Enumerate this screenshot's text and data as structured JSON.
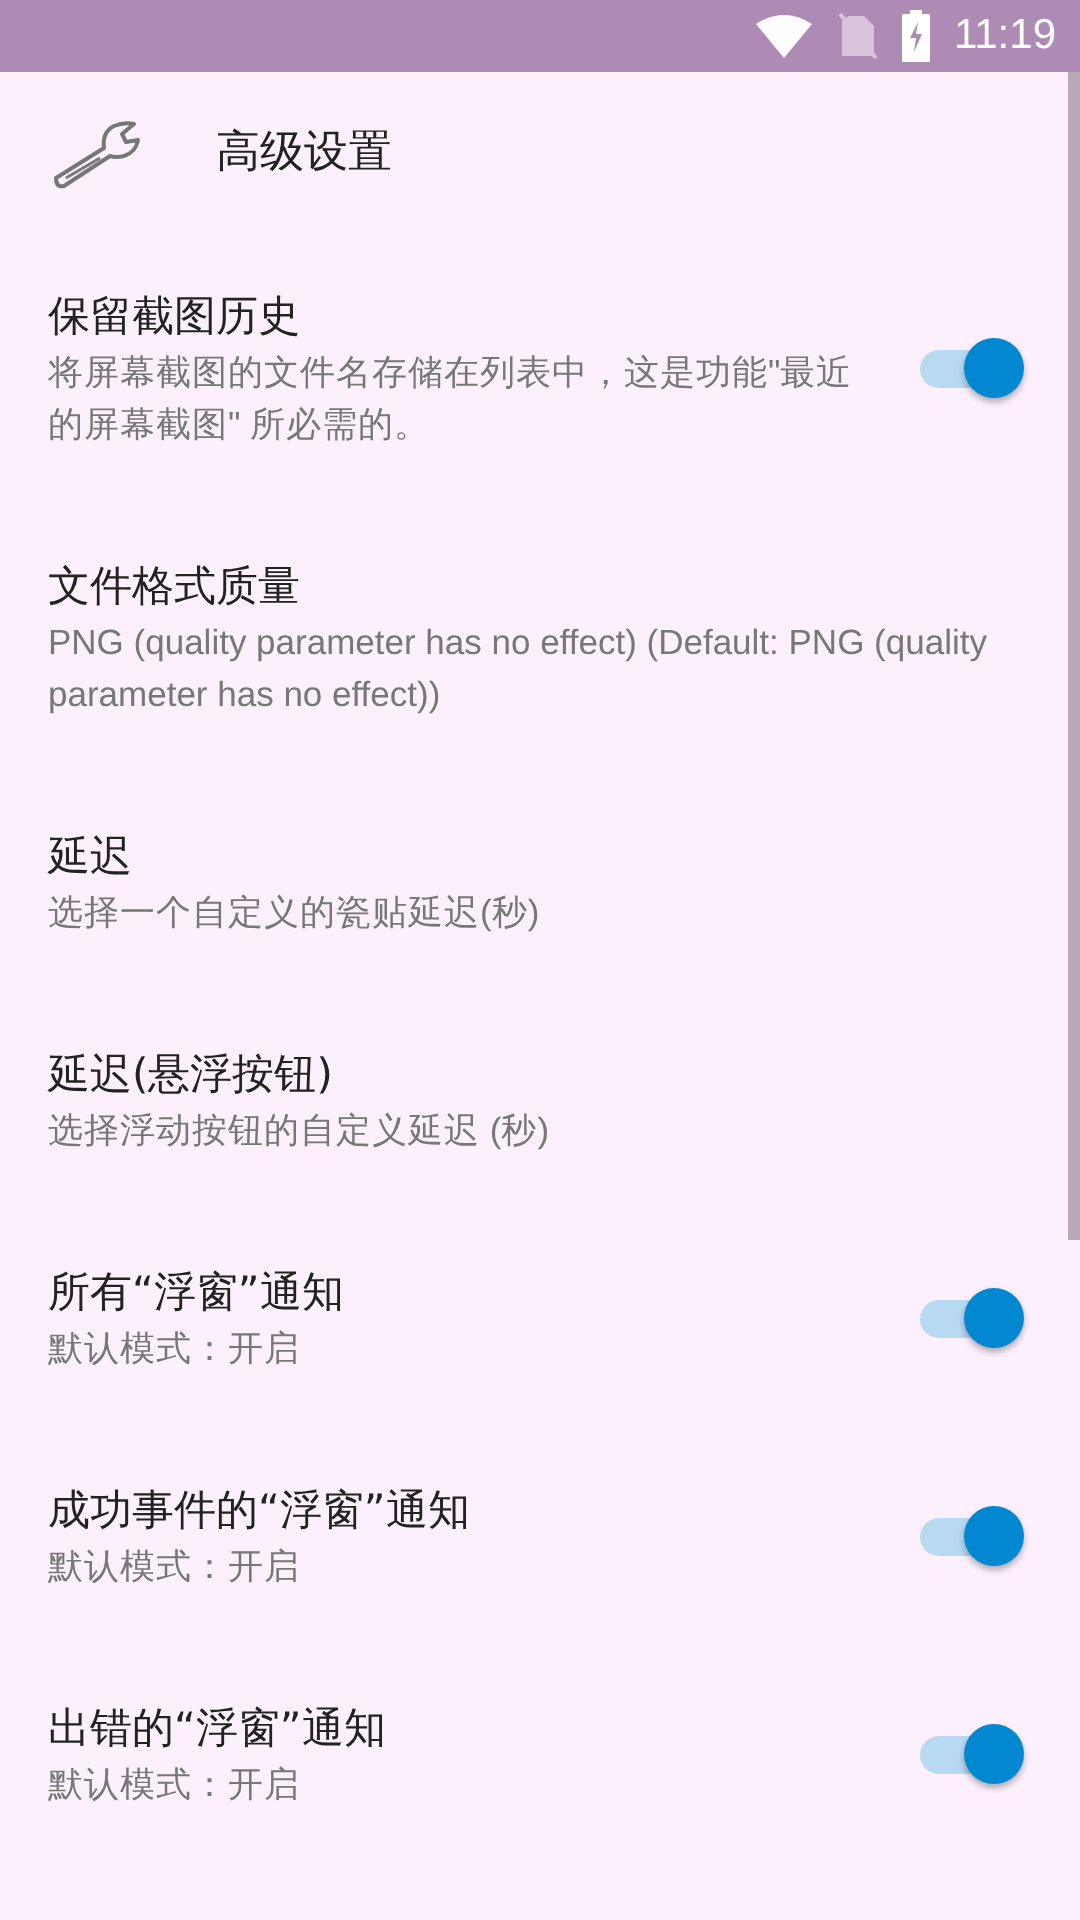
{
  "status_bar": {
    "time": "11:19"
  },
  "header": {
    "title": "高级设置"
  },
  "items": [
    {
      "kind": "switch",
      "title": "保留截图历史",
      "summary": "将屏幕截图的文件名存储在列表中，这是功能\"最近的屏幕截图\" 所必需的。",
      "on": true
    },
    {
      "kind": "plain",
      "title": "文件格式质量",
      "summary": "PNG (quality parameter has no effect) (Default: PNG (quality parameter has no effect))"
    },
    {
      "kind": "plain",
      "title": "延迟",
      "summary": "选择一个自定义的瓷贴延迟(秒)"
    },
    {
      "kind": "plain",
      "title": "延迟(悬浮按钮)",
      "summary": "选择浮动按钮的自定义延迟 (秒)"
    },
    {
      "kind": "switch",
      "title": "所有“浮窗”通知",
      "summary": "默认模式：开启",
      "on": true
    },
    {
      "kind": "switch",
      "title": "成功事件的“浮窗”通知",
      "summary": "默认模式：开启",
      "on": true
    },
    {
      "kind": "switch",
      "title": "出错的“浮窗”通知",
      "summary": "默认模式：开启",
      "on": true
    }
  ]
}
